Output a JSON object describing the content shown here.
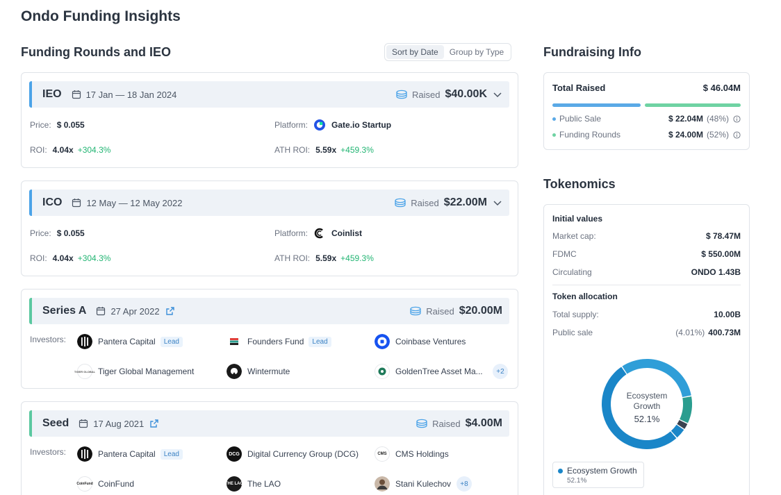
{
  "page_title": "Ondo Funding Insights",
  "rounds_section": {
    "title": "Funding Rounds and IEO",
    "sort_options": [
      "Sort by Date",
      "Group by Type"
    ]
  },
  "rounds": [
    {
      "type": "IEO",
      "date": "17 Jan — 18 Jan 2024",
      "raised_label": "Raised",
      "raised": "$40.00K",
      "price_label": "Price:",
      "price": "$ 0.055",
      "platform_label": "Platform:",
      "platform": "Gate.io Startup",
      "roi_label": "ROI:",
      "roi": "4.04x",
      "roi_pct": "+304.3%",
      "ath_label": "ATH ROI:",
      "ath": "5.59x",
      "ath_pct": "+459.3%"
    },
    {
      "type": "ICO",
      "date": "12 May — 12 May 2022",
      "raised_label": "Raised",
      "raised": "$22.00M",
      "price_label": "Price:",
      "price": "$ 0.055",
      "platform_label": "Platform:",
      "platform": "Coinlist",
      "roi_label": "ROI:",
      "roi": "4.04x",
      "roi_pct": "+304.3%",
      "ath_label": "ATH ROI:",
      "ath": "5.59x",
      "ath_pct": "+459.3%"
    },
    {
      "type": "Series A",
      "date": "27 Apr 2022",
      "raised_label": "Raised",
      "raised": "$20.00M",
      "investors_label": "Investors:",
      "investors": [
        "Pantera Capital",
        "Founders Fund",
        "Coinbase Ventures",
        "Tiger Global Management",
        "Wintermute",
        "GoldenTree Asset Ma..."
      ],
      "lead_label": "Lead",
      "more": "+2"
    },
    {
      "type": "Seed",
      "date": "17 Aug 2021",
      "raised_label": "Raised",
      "raised": "$4.00M",
      "investors_label": "Investors:",
      "investors": [
        "Pantera Capital",
        "Digital Currency Group (DCG)",
        "CMS Holdings",
        "CoinFund",
        "The LAO",
        "Stani Kulechov"
      ],
      "lead_label": "Lead",
      "more": "+8"
    }
  ],
  "logo_text": {
    "tiger": "TIGER GLOBAL",
    "dcg": "DCG",
    "cms": "CMS",
    "coinfund": "CoinFund",
    "lao": "THE LAO"
  },
  "fundraising": {
    "title": "Fundraising Info",
    "total_label": "Total Raised",
    "total": "$ 46.04M",
    "public_label": "Public Sale",
    "public_value": "$ 22.04M",
    "public_pct": "(48%)",
    "public_fraction": 0.48,
    "funding_label": "Funding Rounds",
    "funding_value": "$ 24.00M",
    "funding_pct": "(52%)",
    "funding_fraction": 0.52,
    "public_color": "#5aa9e6",
    "funding_color": "#6fd3a3"
  },
  "tokenomics": {
    "title": "Tokenomics",
    "initial_label": "Initial values",
    "market_cap_label": "Market cap:",
    "market_cap": "$ 78.47M",
    "fdmc_label": "FDMC",
    "fdmc": "$ 550.00M",
    "circ_label": "Circulating",
    "circ": "ONDO 1.43B",
    "alloc_label": "Token allocation",
    "supply_label": "Total supply:",
    "supply": "10.00B",
    "public_sale_label": "Public sale",
    "public_sale_pct": "(4.01%)",
    "public_sale": "400.73M",
    "donut_center_label_line1": "Ecosystem",
    "donut_center_label_line2": "Growth",
    "donut_center_value": "52.1%",
    "legend_label": "Ecosystem Growth",
    "legend_value": "52.1%"
  },
  "chart_data": {
    "type": "pie",
    "slices": [
      {
        "value": 52.1,
        "color": "#1a86c8"
      },
      {
        "value": 31.5,
        "color": "#2f9ed8"
      },
      {
        "value": 10.0,
        "color": "#2a9d8f"
      },
      {
        "value": 2.4,
        "color": "#3b4350"
      },
      {
        "value": 4.0,
        "color": "#1a86c8"
      }
    ]
  }
}
